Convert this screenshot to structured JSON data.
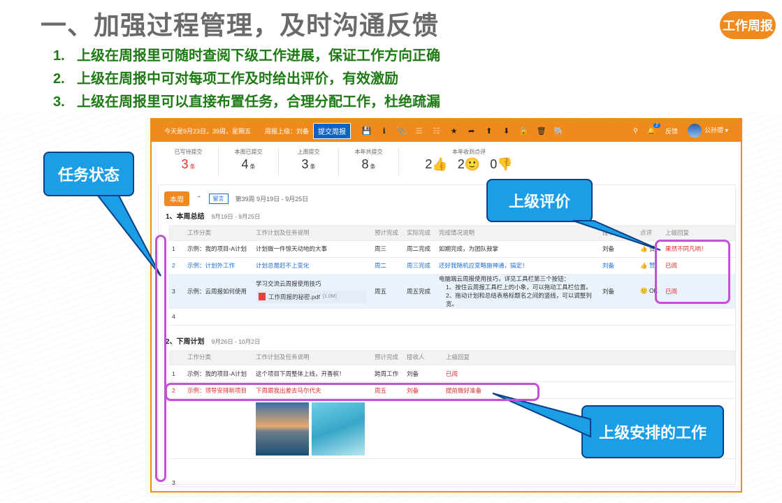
{
  "slide": {
    "title": "一、加强过程管理，及时沟通反馈",
    "logo": "工作周报",
    "points": [
      {
        "num": "1.",
        "text": "上级在周报里可随时查阅下级工作进展，保证工作方向正确"
      },
      {
        "num": "2.",
        "text": "上级在周报中可对每项工作及时给出评价，有效激励"
      },
      {
        "num": "3.",
        "text": "上级在周报里可以直接布置任务，合理分配工作，杜绝疏漏"
      }
    ]
  },
  "callouts": {
    "status": "任务状态",
    "eval": "上级评价",
    "assigned": "上级安排的工作"
  },
  "topbar": {
    "date": "今天是9月23日，39周，星期五",
    "supervisor": "周报上级：刘备",
    "submit": "提交周报",
    "feedback": "反馈",
    "notif_count": "2",
    "user": "公孙瓒 ▾"
  },
  "stats": [
    {
      "label": "已写待提交",
      "value": "3",
      "unit": "条"
    },
    {
      "label": "本周已提交",
      "value": "4",
      "unit": "条"
    },
    {
      "label": "上周提交",
      "value": "3",
      "unit": "条"
    },
    {
      "label": "本年共提交",
      "value": "8",
      "unit": "条"
    }
  ],
  "praise": {
    "label": "本年收到点评",
    "likes": "2👍",
    "smiles": "2🙂",
    "dislikes": "0👎"
  },
  "week": {
    "tab": "本周",
    "msg": "留言",
    "info": "第39周 9月19日 - 9月25日"
  },
  "summary": {
    "title": "1、本周总结",
    "range": "9月19日 - 9月25日",
    "headers": [
      "",
      "工作分类",
      "工作计划及任务说明",
      "预计完成",
      "实际完成",
      "完成情况说明",
      "接收人",
      "点评",
      "上级回复"
    ],
    "rows": [
      {
        "n": "1",
        "cat": "示例：我的项目-A计划",
        "plan": "计划做一件惊天动地的大事",
        "est": "周三",
        "act": "周二完成",
        "desc": "如期完成，为团队鼓掌",
        "recv": "刘备",
        "rate": "👍 赞",
        "reply": "果然不同凡响！"
      },
      {
        "n": "2",
        "cat": "示例：计划外工作",
        "plan": "计划总是赶不上变化",
        "est": "周二",
        "act": "周三完成",
        "desc": "还好我随机应变略施神通，搞定！",
        "recv": "刘备",
        "rate": "👍 赞",
        "reply": "已阅"
      },
      {
        "n": "3",
        "cat": "示例：云周报如何使用",
        "plan": "学习交流云周报使用技巧",
        "est": "周五",
        "act": "周五完成",
        "desc": "电脑端云周报使用技巧，详见工具栏第三个按钮：",
        "desc2": "1、按住云周报工具栏上的小象，可以拖动工具栏位置。",
        "desc3": "2、拖动计划和总结表格标题名之间的竖线，可以调整列宽。",
        "recv": "刘备",
        "rate": "🙂 OK",
        "reply": "已阅",
        "file": "工作周报的秘密.pdf",
        "size": "(1.0M)"
      },
      {
        "n": "4"
      }
    ]
  },
  "nextweek": {
    "title": "2、下周计划",
    "range": "9月26日 - 10月2日",
    "headers": [
      "",
      "工作分类",
      "工作计划及任务说明",
      "预计完成",
      "接收人",
      "上级回复"
    ],
    "rows": [
      {
        "n": "1",
        "cat": "示例：我的项目-A计划",
        "plan": "这个项目下周整体上线，开香槟！",
        "est": "跨周工作",
        "recv": "刘备",
        "reply": "已阅"
      },
      {
        "n": "2",
        "cat": "示例：领导安排新项目",
        "plan": "下周跟我出差去马尔代夫",
        "est": "周五",
        "recv": "刘备",
        "reply": "提前做好准备"
      },
      {
        "n": "3"
      }
    ]
  }
}
